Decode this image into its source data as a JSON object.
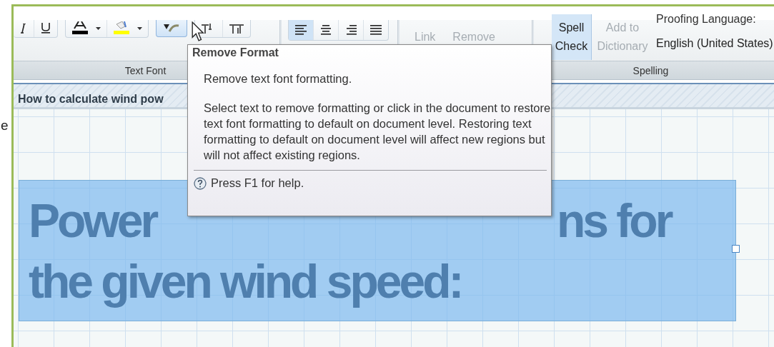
{
  "text_font": {
    "label": "Text Font",
    "buttons": [
      {
        "kind": "italic",
        "hovered": false
      },
      {
        "kind": "underline",
        "hovered": false
      },
      {
        "kind": "font-color",
        "hovered": false,
        "color": "#000000"
      },
      {
        "kind": "highlight",
        "hovered": false,
        "color": "#ffff00"
      },
      {
        "kind": "remove-format",
        "hovered": true
      },
      {
        "kind": "superscript",
        "hovered": false
      },
      {
        "kind": "subscript",
        "hovered": false
      }
    ]
  },
  "paragraph": {
    "align_buttons": [
      {
        "kind": "left",
        "selected": true
      },
      {
        "kind": "center",
        "selected": false
      },
      {
        "kind": "right",
        "selected": false
      },
      {
        "kind": "justify",
        "selected": false
      }
    ]
  },
  "links": {
    "buttons": [
      {
        "label": "Link",
        "disabled": true
      },
      {
        "label": "Remove",
        "disabled": true
      }
    ]
  },
  "spelling": {
    "label": "Spelling",
    "spell_check": {
      "label": "Spell Check",
      "selected": true
    },
    "add_to_dictionary": {
      "label": "Add to Dictionary",
      "disabled": true
    },
    "language_label": "Proofing Language:",
    "language": "English (United States)"
  },
  "margin_text": "e",
  "document_tab": {
    "title": "How to calculate wind pow"
  },
  "heading": {
    "lines": [
      [
        "Power",
        "ns for"
      ],
      [
        "the given wind speed:"
      ]
    ],
    "selected": true
  },
  "tooltip": {
    "title": "Remove Format",
    "summary": "Remove text font formatting.",
    "details": "Select text to remove formatting or click in the document to restore text font formatting to default on document level. Restoring text formatting to default on document level will affect new regions but will not affect existing regions.",
    "help": "Press F1 for help."
  }
}
